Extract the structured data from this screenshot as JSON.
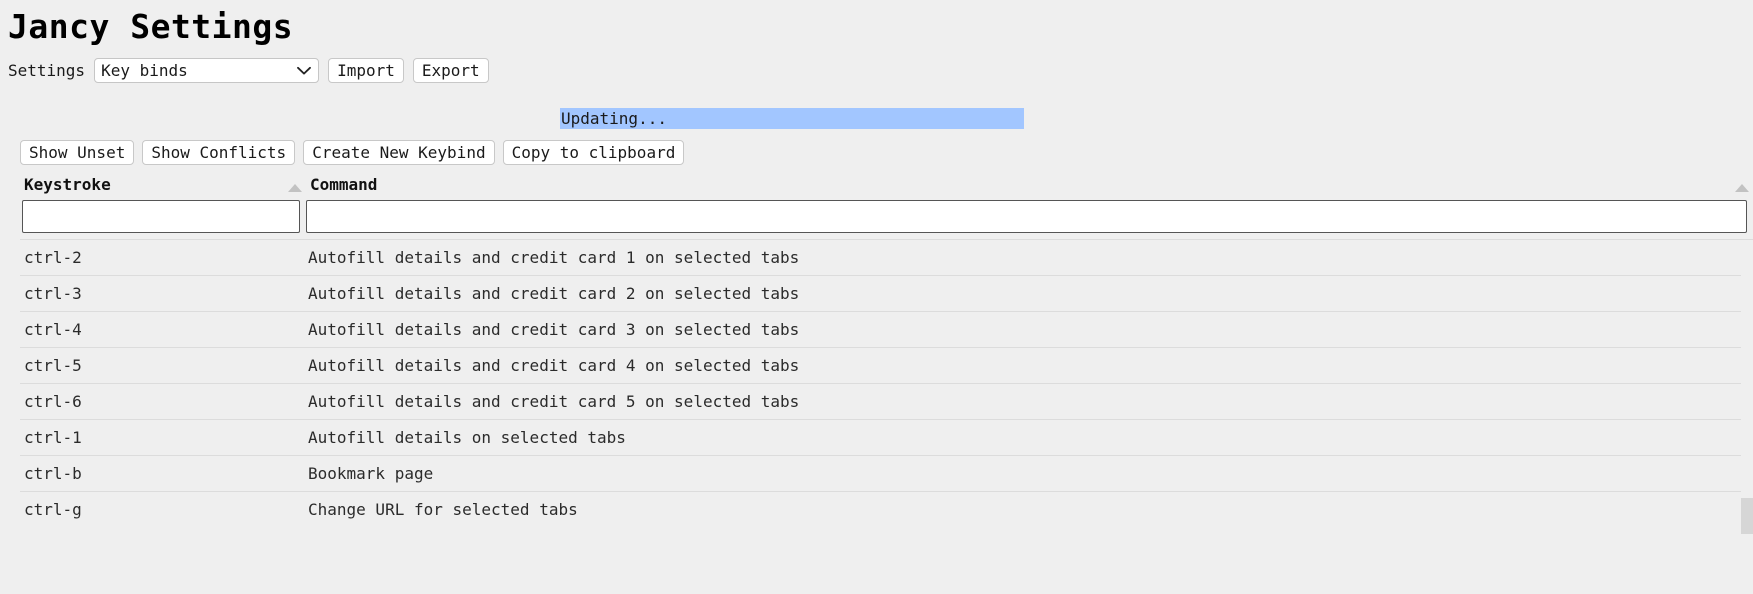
{
  "page": {
    "title": "Jancy Settings"
  },
  "settings_bar": {
    "label": "Settings",
    "select": {
      "name": "settings-category-select",
      "value": "Key binds",
      "options": [
        "Key binds"
      ],
      "chevron_icon": "chevron-down-icon"
    },
    "import_label": "Import",
    "export_label": "Export"
  },
  "status": {
    "message": "Updating...",
    "highlight_color": "#a2c6ff"
  },
  "actions": {
    "show_unset_label": "Show Unset",
    "show_conflicts_label": "Show Conflicts",
    "create_new_keybind_label": "Create New Keybind",
    "copy_to_clipboard_label": "Copy to clipboard"
  },
  "table": {
    "columns": [
      {
        "key": "keystroke",
        "label": "Keystroke",
        "sort_icon": "sort-ascending-icon"
      },
      {
        "key": "command",
        "label": "Command",
        "sort_icon": "sort-ascending-icon"
      }
    ],
    "filters": {
      "keystroke_value": "",
      "keystroke_placeholder": "",
      "command_value": "",
      "command_placeholder": ""
    },
    "rows": [
      {
        "keystroke": "ctrl-2",
        "command": "Autofill details and credit card 1 on selected tabs"
      },
      {
        "keystroke": "ctrl-3",
        "command": "Autofill details and credit card 2 on selected tabs"
      },
      {
        "keystroke": "ctrl-4",
        "command": "Autofill details and credit card 3 on selected tabs"
      },
      {
        "keystroke": "ctrl-5",
        "command": "Autofill details and credit card 4 on selected tabs"
      },
      {
        "keystroke": "ctrl-6",
        "command": "Autofill details and credit card 5 on selected tabs"
      },
      {
        "keystroke": "ctrl-1",
        "command": "Autofill details on selected tabs"
      },
      {
        "keystroke": "ctrl-b",
        "command": "Bookmark page"
      },
      {
        "keystroke": "ctrl-g",
        "command": "Change URL for selected tabs"
      }
    ]
  }
}
